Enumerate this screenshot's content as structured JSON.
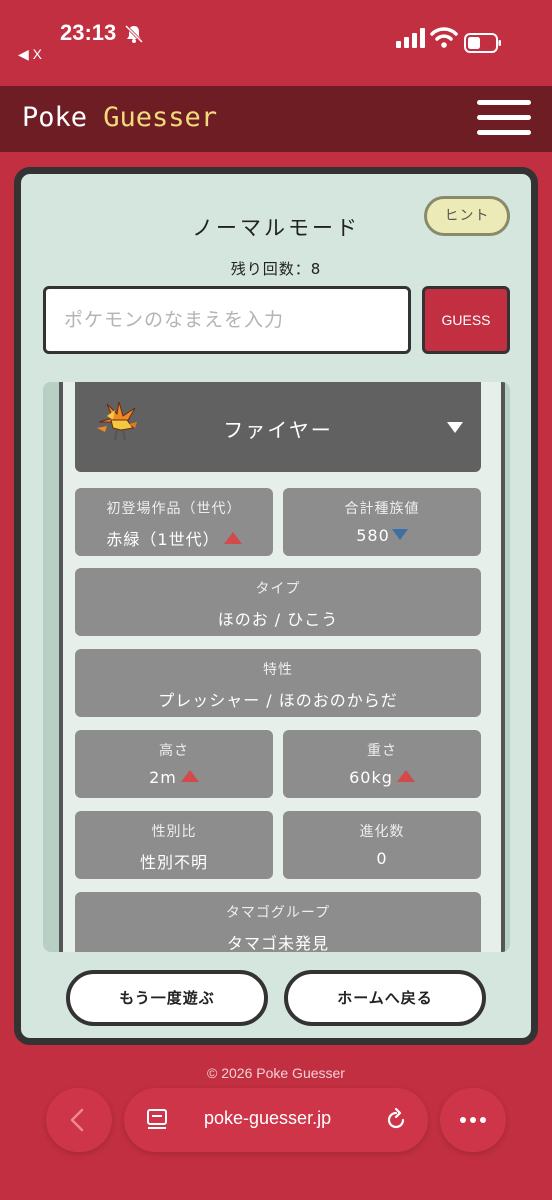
{
  "status_bar": {
    "time": "23:13",
    "back_app": "◀ X"
  },
  "header": {
    "logo_part1": "Poke ",
    "logo_part2": "Guesser"
  },
  "game": {
    "mode_title": "ノーマルモード",
    "hint_label": "ヒント",
    "remaining_label": "残り回数：8",
    "input_placeholder": "ポケモンのなまえを入力",
    "guess_label": "GUESS"
  },
  "result": {
    "pokemon_name": "ファイヤー",
    "fields": {
      "generation": {
        "label": "初登場作品（世代）",
        "value": "赤緑（1世代）",
        "trend": "up"
      },
      "base_stats": {
        "label": "合計種族値",
        "value": "580",
        "trend": "down"
      },
      "type": {
        "label": "タイプ",
        "value": "ほのお / ひこう"
      },
      "ability": {
        "label": "特性",
        "value": "プレッシャー / ほのおのからだ"
      },
      "height": {
        "label": "高さ",
        "value": "2m",
        "trend": "up"
      },
      "weight": {
        "label": "重さ",
        "value": "60kg",
        "trend": "up"
      },
      "gender": {
        "label": "性別比",
        "value": "性別不明"
      },
      "evolution": {
        "label": "進化数",
        "value": "0"
      },
      "egg_group": {
        "label": "タマゴグループ",
        "value": "タマゴ未発見"
      }
    }
  },
  "actions": {
    "play_again": "もう一度遊ぶ",
    "back_home": "ホームへ戻る"
  },
  "footer": {
    "copyright": "© 2026 Poke Guesser"
  },
  "browser": {
    "url": "poke-guesser.jp"
  },
  "icons": [
    "bell-slash-icon",
    "signal-icon",
    "wifi-icon",
    "battery-icon",
    "hamburger-icon",
    "dropdown-triangle-icon",
    "back-chevron-icon",
    "page-icon",
    "reload-icon",
    "more-icon"
  ],
  "colors": {
    "brand_red": "#c12f40",
    "header_dark": "#6e1d25",
    "panel_bg": "#d4e6dd",
    "up_arrow": "#d24a4a",
    "down_arrow": "#3c6ea8"
  }
}
